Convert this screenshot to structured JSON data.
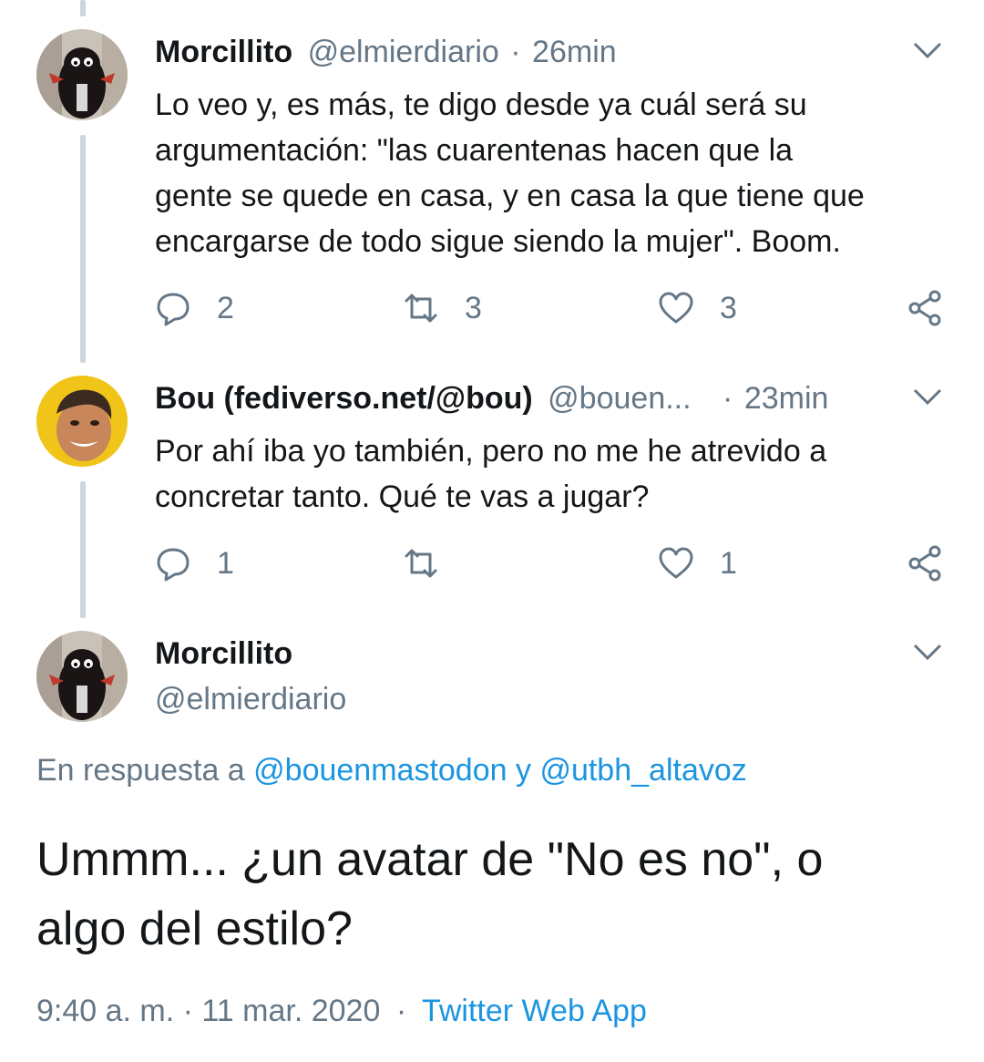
{
  "tweets": [
    {
      "name": "Morcillito",
      "handle": "@elmierdiario",
      "separator": "·",
      "time": "26min",
      "text_lines": [
        "Lo veo y, es más, te digo desde ya cuál será su",
        "argumentación: \"las cuarentenas hacen que la",
        "gente se quede en casa, y en casa la que tiene que",
        "encargarse de todo sigue siendo la mujer\". Boom."
      ],
      "replies": "2",
      "retweets": "3",
      "likes": "3"
    },
    {
      "name": "Bou (fediverso.net/@bou)",
      "handle": "@bouen...",
      "separator": "·",
      "time": "23min",
      "text_lines": [
        "Por ahí iba yo también, pero no me he atrevido a",
        "concretar tanto. Qué te vas a jugar?"
      ],
      "replies": "1",
      "retweets": "",
      "likes": "1"
    }
  ],
  "main_tweet": {
    "name": "Morcillito",
    "handle": "@elmierdiario",
    "reply_prefix": "En respuesta a",
    "mention1": "@bouenmastodon",
    "conjunction": "y",
    "mention2": "@utbh_altavoz",
    "text_line1": "Ummm... ¿un avatar de \"No es no\", o",
    "text_line2": "algo del estilo?",
    "timestamp": "9:40 a. m. · 11 mar. 2020",
    "separator": "·",
    "app": "Twitter Web App"
  },
  "icons": {
    "reply": "reply-icon",
    "retweet": "retweet-icon",
    "like": "heart-icon",
    "share": "share-icon",
    "menu": "chevron-down-icon"
  },
  "colors": {
    "link": "#1b95e0",
    "secondary": "#657786",
    "thread_line": "#ccd6dd"
  }
}
